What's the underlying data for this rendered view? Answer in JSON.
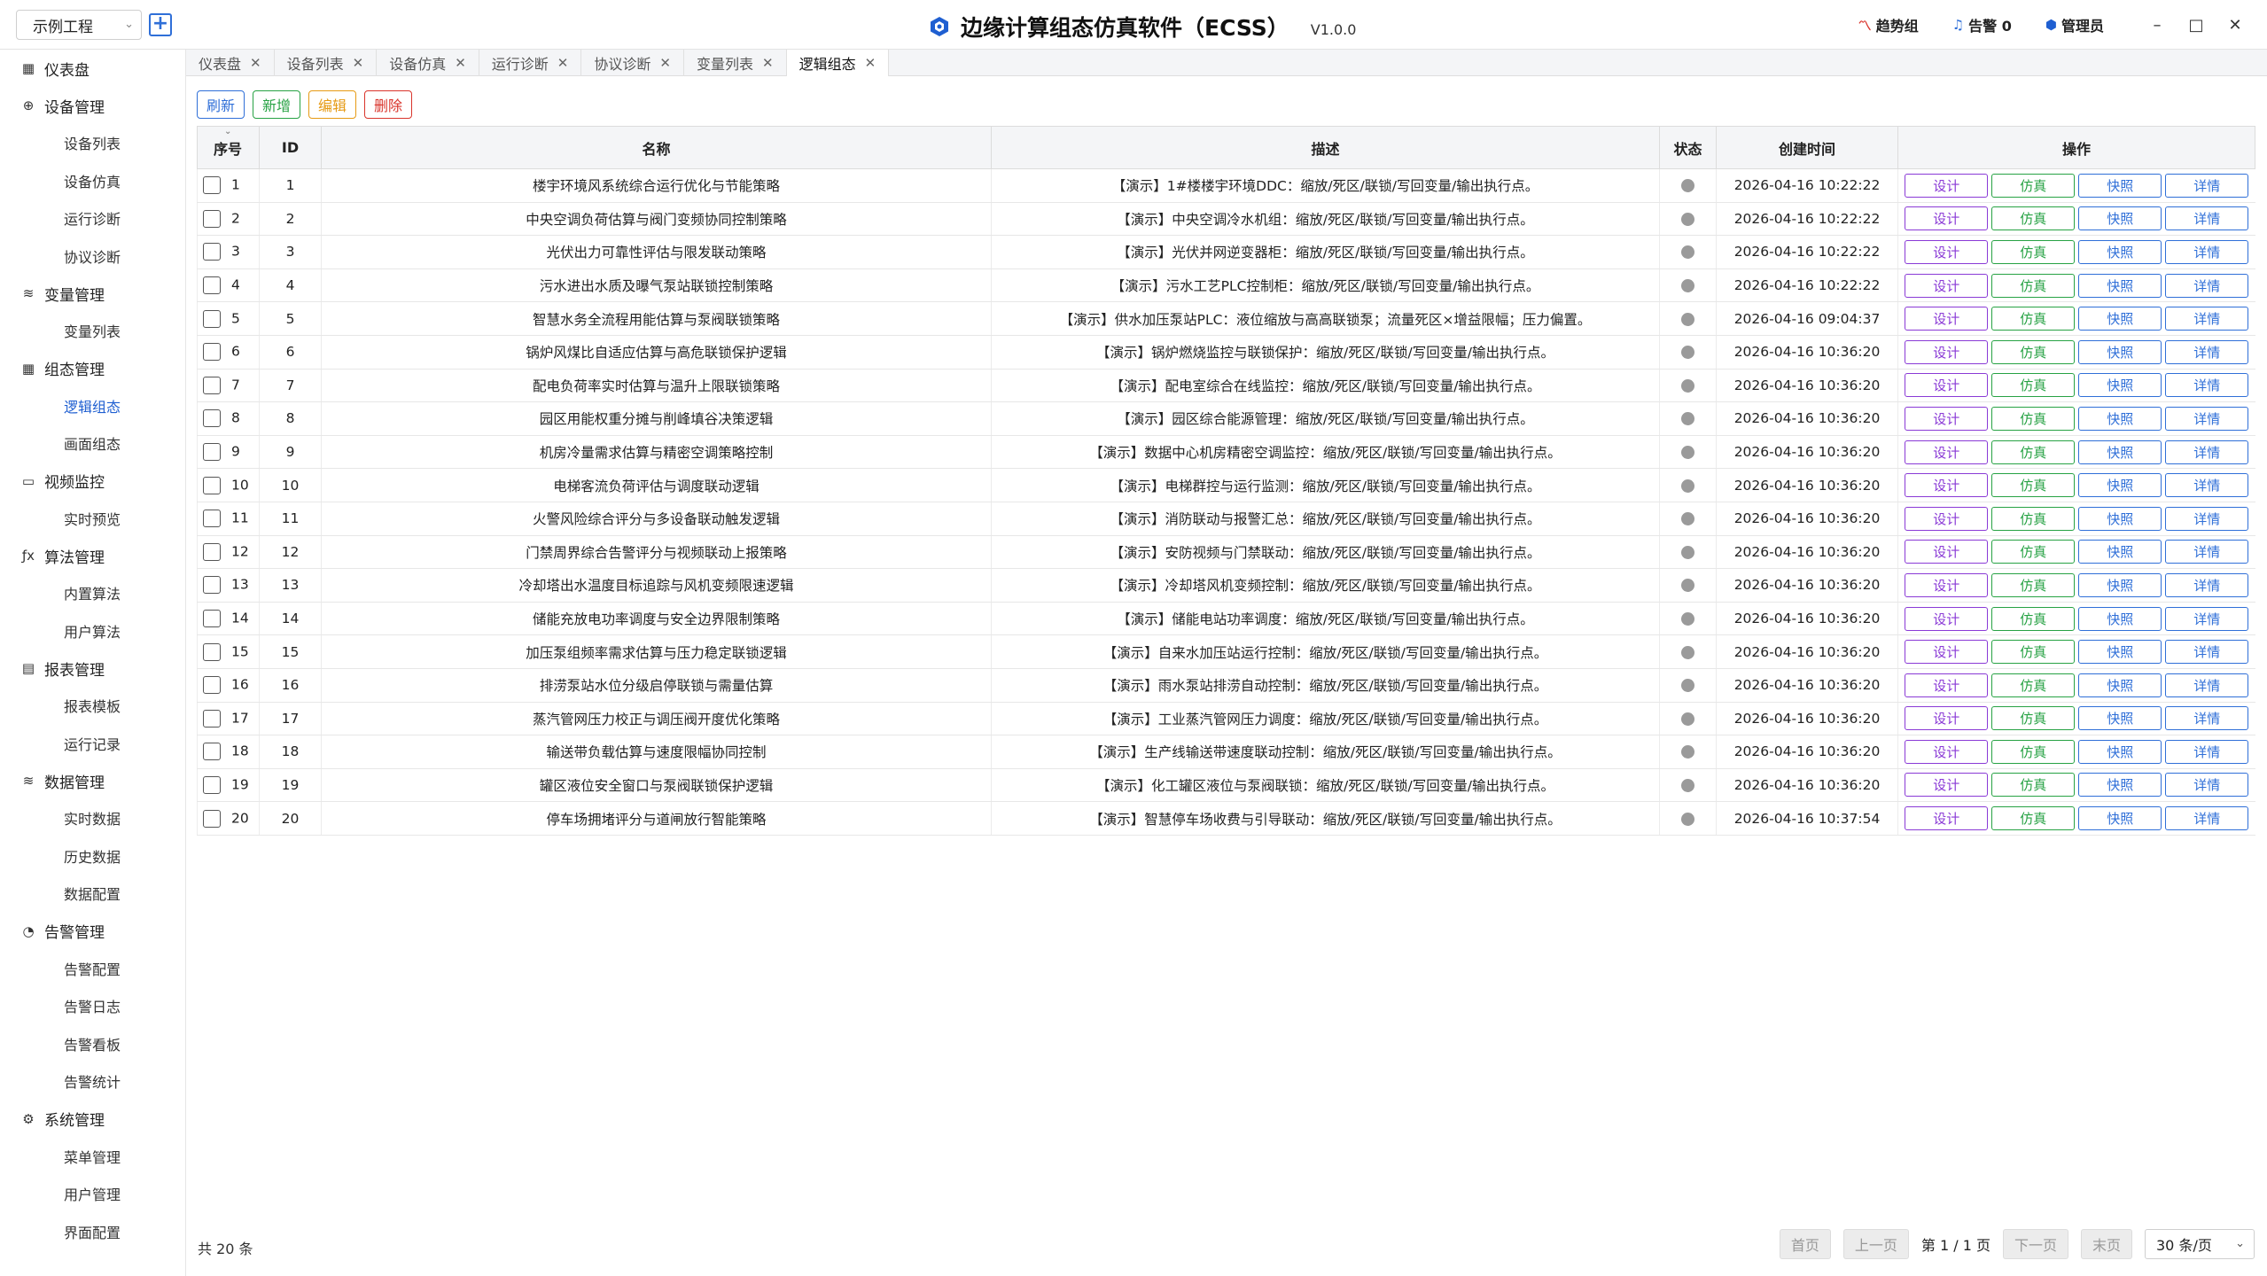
{
  "header": {
    "project_name": "示例工程",
    "add_symbol": "+",
    "title": "边缘计算组态仿真软件（ECSS）",
    "version": "V1.0.0",
    "trend": "趋势组",
    "alarm": "告警 0",
    "user": "管理员",
    "win_min": "–",
    "win_max": "□",
    "win_close": "✕"
  },
  "sidebar": {
    "groups": [
      {
        "label": "仪表盘",
        "icon": "dashboard-icon",
        "glyph": "▦",
        "items": []
      },
      {
        "label": "设备管理",
        "icon": "device-icon",
        "glyph": "⊕",
        "items": [
          "设备列表",
          "设备仿真",
          "运行诊断",
          "协议诊断"
        ]
      },
      {
        "label": "变量管理",
        "icon": "database-icon",
        "glyph": "≋",
        "items": [
          "变量列表"
        ]
      },
      {
        "label": "组态管理",
        "icon": "grid-icon",
        "glyph": "▦",
        "items": [
          "逻辑组态",
          "画面组态"
        ]
      },
      {
        "label": "视频监控",
        "icon": "folder-icon",
        "glyph": "▭",
        "items": [
          "实时预览"
        ]
      },
      {
        "label": "算法管理",
        "icon": "function-icon",
        "glyph": "ƒx",
        "items": [
          "内置算法",
          "用户算法"
        ]
      },
      {
        "label": "报表管理",
        "icon": "report-icon",
        "glyph": "▤",
        "items": [
          "报表模板",
          "运行记录"
        ]
      },
      {
        "label": "数据管理",
        "icon": "layers-icon",
        "glyph": "≋",
        "items": [
          "实时数据",
          "历史数据",
          "数据配置"
        ]
      },
      {
        "label": "告警管理",
        "icon": "bell-icon",
        "glyph": "◔",
        "items": [
          "告警配置",
          "告警日志",
          "告警看板",
          "告警统计"
        ]
      },
      {
        "label": "系统管理",
        "icon": "gear-icon",
        "glyph": "⚙",
        "items": [
          "菜单管理",
          "用户管理",
          "界面配置"
        ]
      }
    ]
  },
  "tabs": [
    {
      "label": "仪表盘",
      "active": false
    },
    {
      "label": "设备列表",
      "active": false
    },
    {
      "label": "设备仿真",
      "active": false
    },
    {
      "label": "运行诊断",
      "active": false
    },
    {
      "label": "协议诊断",
      "active": false
    },
    {
      "label": "变量列表",
      "active": false
    },
    {
      "label": "逻辑组态",
      "active": true
    }
  ],
  "toolbar": {
    "refresh": "刷新",
    "add": "新增",
    "edit": "编辑",
    "delete": "删除"
  },
  "table": {
    "headers": {
      "seq": "序号",
      "id": "ID",
      "name": "名称",
      "desc": "描述",
      "status": "状态",
      "created": "创建时间",
      "ops": "操作"
    },
    "op_labels": {
      "design": "设计",
      "sim": "仿真",
      "snap": "快照",
      "detail": "详情"
    },
    "rows": [
      {
        "seq": "1",
        "id": "1",
        "name": "楼宇环境风系统综合运行优化与节能策略",
        "desc": "【演示】1#楼楼宇环境DDC：缩放/死区/联锁/写回变量/输出执行点。",
        "created": "2026-04-16 10:22:22"
      },
      {
        "seq": "2",
        "id": "2",
        "name": "中央空调负荷估算与阀门变频协同控制策略",
        "desc": "【演示】中央空调冷水机组：缩放/死区/联锁/写回变量/输出执行点。",
        "created": "2026-04-16 10:22:22"
      },
      {
        "seq": "3",
        "id": "3",
        "name": "光伏出力可靠性评估与限发联动策略",
        "desc": "【演示】光伏并网逆变器柜：缩放/死区/联锁/写回变量/输出执行点。",
        "created": "2026-04-16 10:22:22"
      },
      {
        "seq": "4",
        "id": "4",
        "name": "污水进出水质及曝气泵站联锁控制策略",
        "desc": "【演示】污水工艺PLC控制柜：缩放/死区/联锁/写回变量/输出执行点。",
        "created": "2026-04-16 10:22:22"
      },
      {
        "seq": "5",
        "id": "5",
        "name": "智慧水务全流程用能估算与泵阀联锁策略",
        "desc": "【演示】供水加压泵站PLC：液位缩放与高高联锁泵；流量死区×增益限幅；压力偏置。",
        "created": "2026-04-16 09:04:37"
      },
      {
        "seq": "6",
        "id": "6",
        "name": "锅炉风煤比自适应估算与高危联锁保护逻辑",
        "desc": "【演示】锅炉燃烧监控与联锁保护：缩放/死区/联锁/写回变量/输出执行点。",
        "created": "2026-04-16 10:36:20"
      },
      {
        "seq": "7",
        "id": "7",
        "name": "配电负荷率实时估算与温升上限联锁策略",
        "desc": "【演示】配电室综合在线监控：缩放/死区/联锁/写回变量/输出执行点。",
        "created": "2026-04-16 10:36:20"
      },
      {
        "seq": "8",
        "id": "8",
        "name": "园区用能权重分摊与削峰填谷决策逻辑",
        "desc": "【演示】园区综合能源管理：缩放/死区/联锁/写回变量/输出执行点。",
        "created": "2026-04-16 10:36:20"
      },
      {
        "seq": "9",
        "id": "9",
        "name": "机房冷量需求估算与精密空调策略控制",
        "desc": "【演示】数据中心机房精密空调监控：缩放/死区/联锁/写回变量/输出执行点。",
        "created": "2026-04-16 10:36:20"
      },
      {
        "seq": "10",
        "id": "10",
        "name": "电梯客流负荷评估与调度联动逻辑",
        "desc": "【演示】电梯群控与运行监测：缩放/死区/联锁/写回变量/输出执行点。",
        "created": "2026-04-16 10:36:20"
      },
      {
        "seq": "11",
        "id": "11",
        "name": "火警风险综合评分与多设备联动触发逻辑",
        "desc": "【演示】消防联动与报警汇总：缩放/死区/联锁/写回变量/输出执行点。",
        "created": "2026-04-16 10:36:20"
      },
      {
        "seq": "12",
        "id": "12",
        "name": "门禁周界综合告警评分与视频联动上报策略",
        "desc": "【演示】安防视频与门禁联动：缩放/死区/联锁/写回变量/输出执行点。",
        "created": "2026-04-16 10:36:20"
      },
      {
        "seq": "13",
        "id": "13",
        "name": "冷却塔出水温度目标追踪与风机变频限速逻辑",
        "desc": "【演示】冷却塔风机变频控制：缩放/死区/联锁/写回变量/输出执行点。",
        "created": "2026-04-16 10:36:20"
      },
      {
        "seq": "14",
        "id": "14",
        "name": "储能充放电功率调度与安全边界限制策略",
        "desc": "【演示】储能电站功率调度：缩放/死区/联锁/写回变量/输出执行点。",
        "created": "2026-04-16 10:36:20"
      },
      {
        "seq": "15",
        "id": "15",
        "name": "加压泵组频率需求估算与压力稳定联锁逻辑",
        "desc": "【演示】自来水加压站运行控制：缩放/死区/联锁/写回变量/输出执行点。",
        "created": "2026-04-16 10:36:20"
      },
      {
        "seq": "16",
        "id": "16",
        "name": "排涝泵站水位分级启停联锁与需量估算",
        "desc": "【演示】雨水泵站排涝自动控制：缩放/死区/联锁/写回变量/输出执行点。",
        "created": "2026-04-16 10:36:20"
      },
      {
        "seq": "17",
        "id": "17",
        "name": "蒸汽管网压力校正与调压阀开度优化策略",
        "desc": "【演示】工业蒸汽管网压力调度：缩放/死区/联锁/写回变量/输出执行点。",
        "created": "2026-04-16 10:36:20"
      },
      {
        "seq": "18",
        "id": "18",
        "name": "输送带负载估算与速度限幅协同控制",
        "desc": "【演示】生产线输送带速度联动控制：缩放/死区/联锁/写回变量/输出执行点。",
        "created": "2026-04-16 10:36:20"
      },
      {
        "seq": "19",
        "id": "19",
        "name": "罐区液位安全窗口与泵阀联锁保护逻辑",
        "desc": "【演示】化工罐区液位与泵阀联锁：缩放/死区/联锁/写回变量/输出执行点。",
        "created": "2026-04-16 10:36:20"
      },
      {
        "seq": "20",
        "id": "20",
        "name": "停车场拥堵评分与道闸放行智能策略",
        "desc": "【演示】智慧停车场收费与引导联动：缩放/死区/联锁/写回变量/输出执行点。",
        "created": "2026-04-16 10:37:54"
      }
    ]
  },
  "footer": {
    "total": "共 20 条",
    "first": "首页",
    "prev": "上一页",
    "page_info": "第 1 / 1 页",
    "next": "下一页",
    "last": "末页",
    "page_size": "30 条/页"
  },
  "colors": {
    "accent": "#2f6fd8",
    "success": "#27a244",
    "warning": "#e69a14",
    "danger": "#d9342b",
    "design": "#8a3ad6",
    "status_off": "#9a9a9a"
  }
}
